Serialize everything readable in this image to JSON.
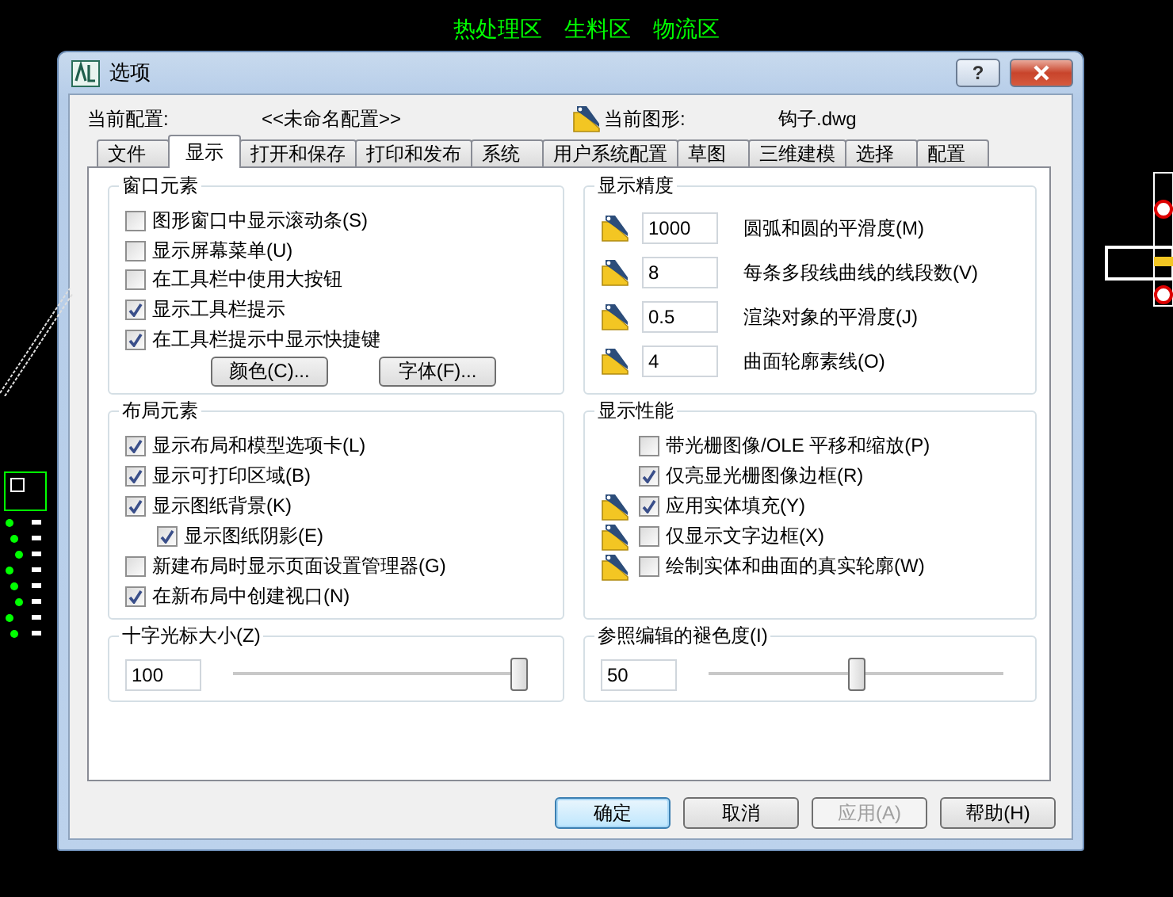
{
  "canvas_labels": [
    "热处理区",
    "生料区",
    "物流区"
  ],
  "window": {
    "title": "选项",
    "help": "?"
  },
  "current_profile": {
    "label": "当前配置:",
    "value": "<<未命名配置>>"
  },
  "current_drawing": {
    "label": "当前图形:",
    "value": "钩子.dwg"
  },
  "tabs": [
    {
      "label": "文件",
      "selected": false
    },
    {
      "label": "显示",
      "selected": true
    },
    {
      "label": "打开和保存",
      "selected": false
    },
    {
      "label": "打印和发布",
      "selected": false
    },
    {
      "label": "系统",
      "selected": false
    },
    {
      "label": "用户系统配置",
      "selected": false
    },
    {
      "label": "草图",
      "selected": false
    },
    {
      "label": "三维建模",
      "selected": false
    },
    {
      "label": "选择",
      "selected": false
    },
    {
      "label": "配置",
      "selected": false
    }
  ],
  "window_elements": {
    "title": "窗口元素",
    "options": [
      {
        "label": "图形窗口中显示滚动条(S)",
        "checked": false
      },
      {
        "label": "显示屏幕菜单(U)",
        "checked": false
      },
      {
        "label": "在工具栏中使用大按钮",
        "checked": false
      },
      {
        "label": "显示工具栏提示",
        "checked": true
      },
      {
        "label": "在工具栏提示中显示快捷键",
        "checked": true
      }
    ],
    "buttons": [
      "颜色(C)...",
      "字体(F)..."
    ]
  },
  "display_resolution": {
    "title": "显示精度",
    "fields": [
      {
        "value": "1000",
        "label": "圆弧和圆的平滑度(M)"
      },
      {
        "value": "8",
        "label": "每条多段线曲线的线段数(V)"
      },
      {
        "value": "0.5",
        "label": "渲染对象的平滑度(J)"
      },
      {
        "value": "4",
        "label": "曲面轮廓素线(O)"
      }
    ]
  },
  "layout_elements": {
    "title": "布局元素",
    "options": [
      {
        "label": "显示布局和模型选项卡(L)",
        "checked": true
      },
      {
        "label": "显示可打印区域(B)",
        "checked": true
      },
      {
        "label": "显示图纸背景(K)",
        "checked": true,
        "children": [
          {
            "label": "显示图纸阴影(E)",
            "checked": true
          }
        ]
      },
      {
        "label": "新建布局时显示页面设置管理器(G)",
        "checked": false
      },
      {
        "label": "在新布局中创建视口(N)",
        "checked": true
      }
    ]
  },
  "display_performance": {
    "title": "显示性能",
    "options": [
      {
        "label": "带光栅图像/OLE 平移和缩放(P)",
        "checked": false,
        "saved_in_drawing": false
      },
      {
        "label": "仅亮显光栅图像边框(R)",
        "checked": true,
        "saved_in_drawing": false
      },
      {
        "label": "应用实体填充(Y)",
        "checked": true,
        "saved_in_drawing": true
      },
      {
        "label": "仅显示文字边框(X)",
        "checked": false,
        "saved_in_drawing": true
      },
      {
        "label": "绘制实体和曲面的真实轮廓(W)",
        "checked": false,
        "saved_in_drawing": true
      }
    ]
  },
  "crosshair_size": {
    "title": "十字光标大小(Z)",
    "value": "100",
    "level": 1.0
  },
  "xref_fade": {
    "title": "参照编辑的褪色度(I)",
    "value": "50",
    "level": 0.5
  },
  "buttons": [
    {
      "label": "确定",
      "default": true,
      "disabled": false
    },
    {
      "label": "取消",
      "default": false,
      "disabled": false
    },
    {
      "label": "应用(A)",
      "default": false,
      "disabled": true
    },
    {
      "label": "帮助(H)",
      "default": false,
      "disabled": false
    }
  ]
}
